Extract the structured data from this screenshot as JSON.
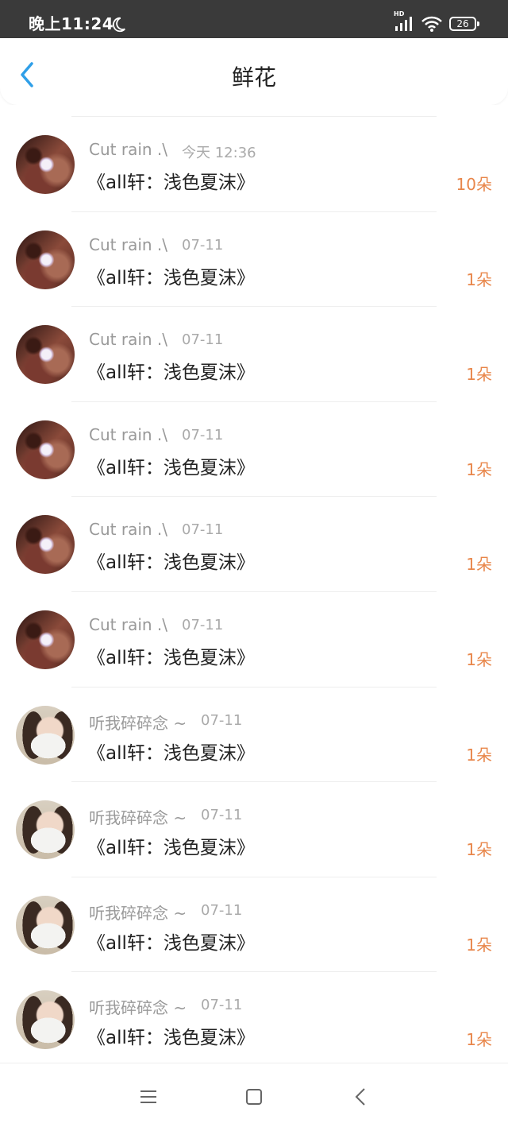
{
  "status_bar": {
    "time": "晚上11:24",
    "network": "HD",
    "battery": "26",
    "icons": [
      "moon-icon",
      "signal-icon",
      "wifi-icon",
      "battery-icon"
    ]
  },
  "header": {
    "title": "鲜花",
    "back_icon": "chevron-left-icon"
  },
  "colors": {
    "accent": "#2f9fe8",
    "count": "#e8864a",
    "name": "#999999",
    "statusbar": "#3a3a3a"
  },
  "list": [
    {
      "name": "Cut rain .\\",
      "date": "今天 12:36",
      "work": "《all轩：浅色夏沫》",
      "count": "10朵",
      "avatar": "avatar-1"
    },
    {
      "name": "Cut rain .\\",
      "date": "07-11",
      "work": "《all轩：浅色夏沫》",
      "count": "1朵",
      "avatar": "avatar-1"
    },
    {
      "name": "Cut rain .\\",
      "date": "07-11",
      "work": "《all轩：浅色夏沫》",
      "count": "1朵",
      "avatar": "avatar-1"
    },
    {
      "name": "Cut rain .\\",
      "date": "07-11",
      "work": "《all轩：浅色夏沫》",
      "count": "1朵",
      "avatar": "avatar-1"
    },
    {
      "name": "Cut rain .\\",
      "date": "07-11",
      "work": "《all轩：浅色夏沫》",
      "count": "1朵",
      "avatar": "avatar-1"
    },
    {
      "name": "Cut rain .\\",
      "date": "07-11",
      "work": "《all轩：浅色夏沫》",
      "count": "1朵",
      "avatar": "avatar-1"
    },
    {
      "name": "听我碎碎念 ~",
      "date": "07-11",
      "work": "《all轩：浅色夏沫》",
      "count": "1朵",
      "avatar": "avatar-2"
    },
    {
      "name": "听我碎碎念 ~",
      "date": "07-11",
      "work": "《all轩：浅色夏沫》",
      "count": "1朵",
      "avatar": "avatar-2"
    },
    {
      "name": "听我碎碎念 ~",
      "date": "07-11",
      "work": "《all轩：浅色夏沫》",
      "count": "1朵",
      "avatar": "avatar-2"
    },
    {
      "name": "听我碎碎念 ~",
      "date": "07-11",
      "work": "《all轩：浅色夏沫》",
      "count": "1朵",
      "avatar": "avatar-2"
    }
  ],
  "nav_bar": {
    "icons": [
      "menu-icon",
      "home-icon",
      "back-icon"
    ]
  }
}
